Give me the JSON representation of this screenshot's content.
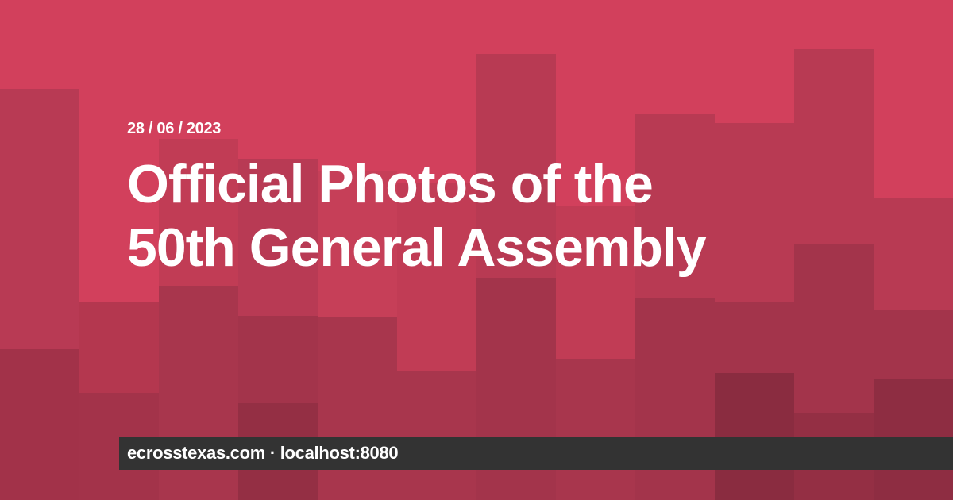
{
  "card": {
    "date": "28 / 06 / 2023",
    "title_line_1": "Official Photos of the",
    "title_line_2": "50th General Assembly",
    "footer_text": "ecrosstexas.com · localhost:8080"
  },
  "colors": {
    "background": "#d2405c",
    "shade_light": "#c13c55",
    "shade_mid": "#ae3a50",
    "shade_dark": "#9b3246",
    "shade_darkest": "#8a2c40",
    "footer_background": "#333333",
    "text": "#ffffff"
  }
}
